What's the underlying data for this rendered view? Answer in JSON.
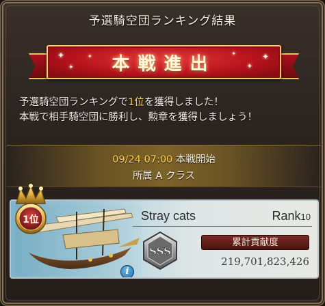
{
  "dialog": {
    "title": "予選騎空団ランキング結果",
    "banner": "本戦進出"
  },
  "message": {
    "line1_prefix": "予選騎空団ランキングで",
    "line1_highlight": "1位",
    "line1_suffix": "を獲得しました！",
    "line2": "本戦で相手騎空団に勝利し、勲章を獲得しましょう！"
  },
  "schedule": {
    "date": "09/24 07:00",
    "event": " 本戦開始",
    "class_label": "所属 A クラス"
  },
  "crew": {
    "rank_position": "1位",
    "name": "Stray cats",
    "rank_label": "Rank",
    "rank_value": "10",
    "grade": "SSS",
    "contribution_label": "累計貢献度",
    "contribution_value": "219,701,823,426",
    "info_icon": "i"
  },
  "colors": {
    "banner_red": "#b8131c",
    "highlight_gold": "#ffd24a",
    "panel_bg": "#2c2420"
  }
}
